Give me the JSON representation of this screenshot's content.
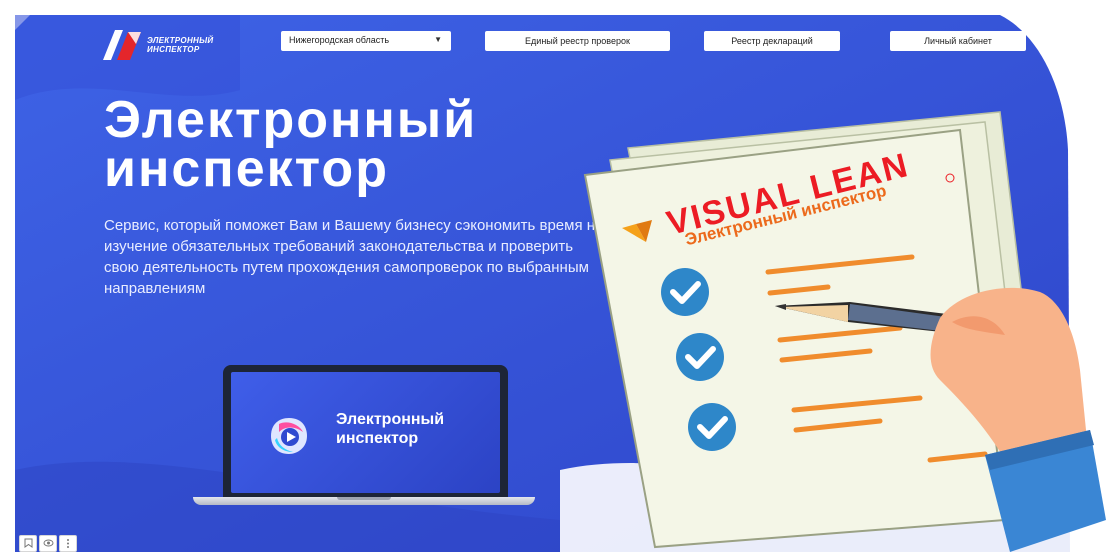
{
  "header": {
    "logo_text": "ЭЛЕКТРОННЫЙ ИНСПЕКТОР",
    "region_select": "Нижегородская область",
    "nav": [
      "Единый реестр проверок",
      "Реестр деклараций",
      "Личный кабинет"
    ]
  },
  "hero": {
    "title": "Электронный инспектор",
    "description": "Сервис, который поможет Вам и Вашему бизнесу сэкономить время на изучение обязательных требований законодательства и проверить свою деятельность путем прохождения самопроверок по выбранным направлениям"
  },
  "laptop": {
    "screen_title": "Электронный инспектор"
  },
  "document": {
    "brand_name": "VISUAL LEAN",
    "brand_sub": "Электронный инспектор",
    "checklist_items": 3
  },
  "toolbar": {
    "icons": [
      "bookmark-icon",
      "view-icon",
      "more-icon"
    ]
  },
  "colors": {
    "background_blue": "#3a5bdc",
    "accent_orange": "#f08c2d",
    "brand_red": "#ec1c24",
    "check_blue": "#2e87c9"
  }
}
